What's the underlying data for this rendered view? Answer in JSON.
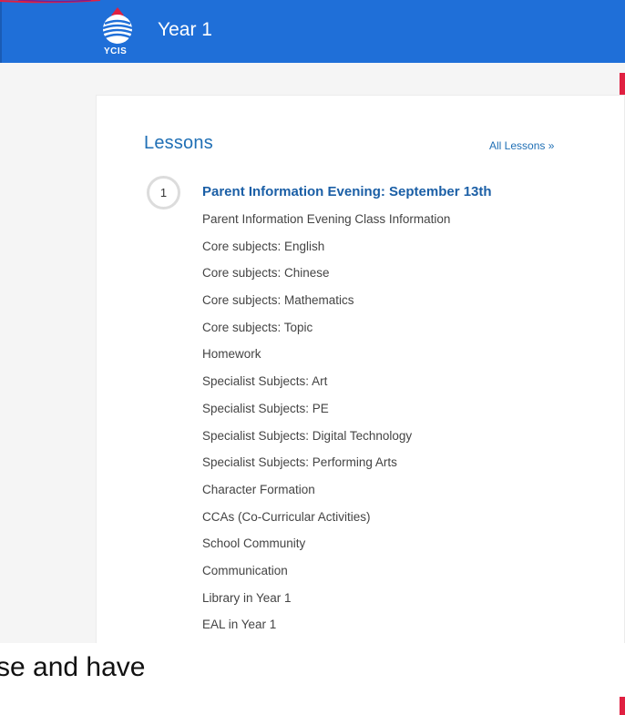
{
  "header": {
    "title": "Year 1",
    "logo_text": "YCIS"
  },
  "lessons": {
    "heading": "Lessons",
    "all_link": "All Lessons »",
    "section": {
      "number": "1",
      "title": "Parent Information Evening: September 13th",
      "items": [
        "Parent Information Evening Class Information",
        "Core subjects: English",
        "Core subjects: Chinese",
        "Core subjects: Mathematics",
        "Core subjects: Topic",
        "Homework",
        "Specialist Subjects: Art",
        "Specialist Subjects: PE",
        "Specialist Subjects: Digital Technology",
        "Specialist Subjects: Performing Arts",
        "Character Formation",
        "CCAs (Co-Curricular Activities)",
        "School Community",
        "Communication",
        "Library in Year 1",
        "EAL in Year 1"
      ]
    }
  },
  "overlay": {
    "text": "rse and have"
  },
  "colors": {
    "header_bg": "#1f6fd8",
    "link": "#1f6fb5",
    "accent_red": "#e02041"
  }
}
